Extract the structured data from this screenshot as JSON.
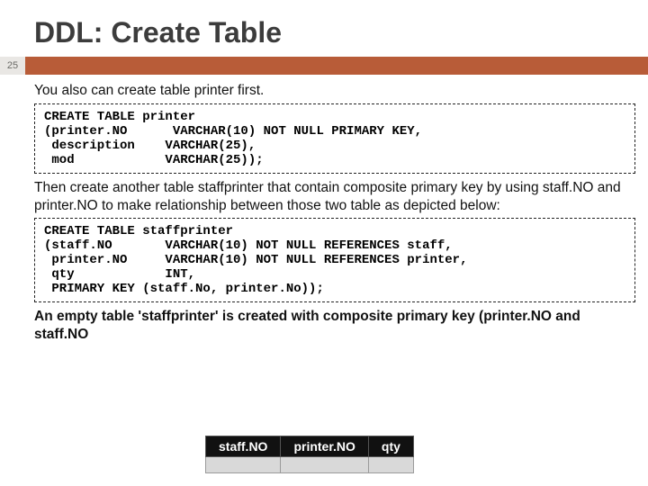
{
  "title": "DDL: Create Table",
  "page_number": "25",
  "intro1": "You also can create table printer first.",
  "code1": "CREATE TABLE printer\n(printer.NO      VARCHAR(10) NOT NULL PRIMARY KEY,\n description    VARCHAR(25),\n mod            VARCHAR(25));",
  "intro2": "Then create another table staffprinter that contain composite primary key by using staff.NO and printer.NO to make relationship between those two table as depicted below:",
  "code2": "CREATE TABLE staffprinter\n(staff.NO       VARCHAR(10) NOT NULL REFERENCES staff,\n printer.NO     VARCHAR(10) NOT NULL REFERENCES printer,\n qty            INT,\n PRIMARY KEY (staff.No, printer.No));",
  "result_text": "An empty table 'staffprinter' is created with composite primary key (printer.NO and staff.NO",
  "table": {
    "headers": [
      "staff.NO",
      "printer.NO",
      "qty"
    ]
  }
}
